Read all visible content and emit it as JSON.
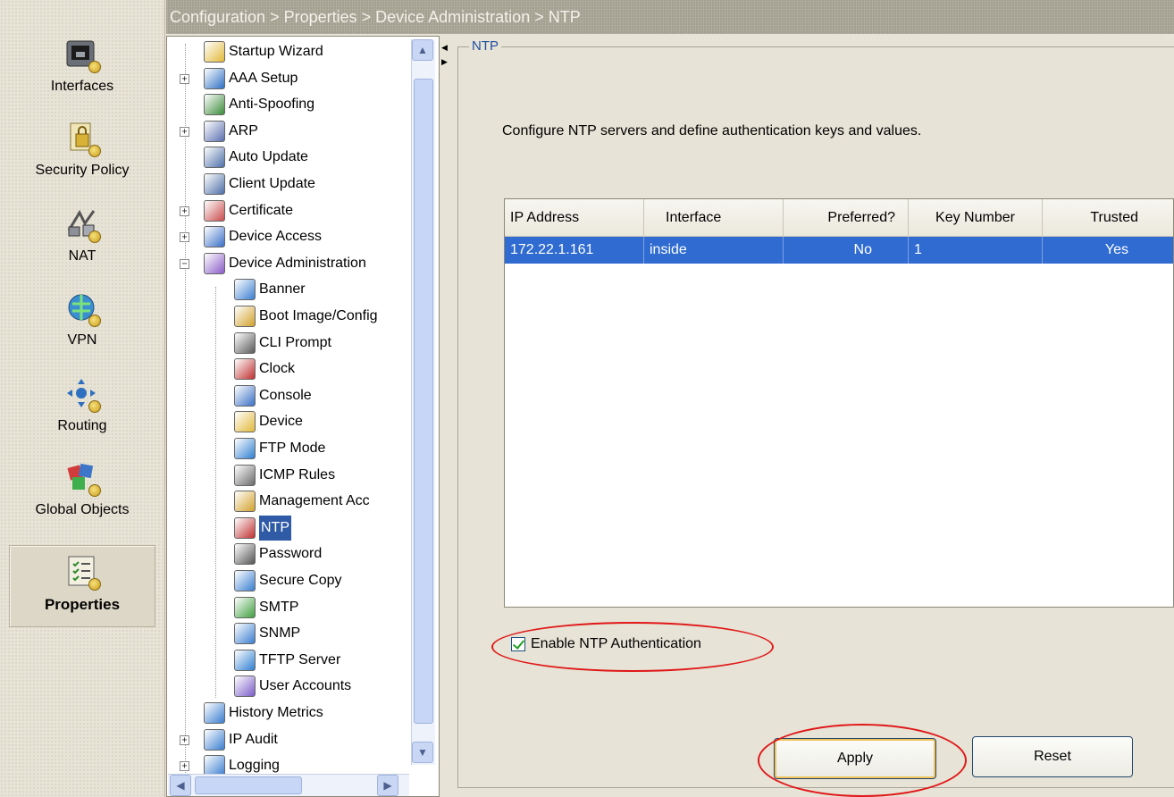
{
  "breadcrumb": "Configuration > Properties > Device Administration > NTP",
  "nav": {
    "items": [
      {
        "label": "Interfaces",
        "icon": "interfaces-icon"
      },
      {
        "label": "Security Policy",
        "icon": "security-policy-icon"
      },
      {
        "label": "NAT",
        "icon": "nat-icon"
      },
      {
        "label": "VPN",
        "icon": "vpn-icon"
      },
      {
        "label": "Routing",
        "icon": "routing-icon"
      },
      {
        "label": "Global Objects",
        "icon": "global-objects-icon"
      },
      {
        "label": "Properties",
        "icon": "properties-icon",
        "active": true
      }
    ]
  },
  "tree": {
    "items": [
      {
        "label": "Startup Wizard"
      },
      {
        "label": "AAA Setup",
        "expander": "+"
      },
      {
        "label": "Anti-Spoofing"
      },
      {
        "label": "ARP",
        "expander": "+"
      },
      {
        "label": "Auto Update"
      },
      {
        "label": "Client Update"
      },
      {
        "label": "Certificate",
        "expander": "+"
      },
      {
        "label": "Device Access",
        "expander": "+"
      },
      {
        "label": "Device Administration",
        "expander": "−"
      },
      {
        "label": "Banner"
      },
      {
        "label": "Boot Image/Config"
      },
      {
        "label": "CLI Prompt"
      },
      {
        "label": "Clock"
      },
      {
        "label": "Console"
      },
      {
        "label": "Device"
      },
      {
        "label": "FTP Mode"
      },
      {
        "label": "ICMP Rules"
      },
      {
        "label": "Management Acc"
      },
      {
        "label": "NTP",
        "selected": true
      },
      {
        "label": "Password"
      },
      {
        "label": "Secure Copy"
      },
      {
        "label": "SMTP"
      },
      {
        "label": "SNMP"
      },
      {
        "label": "TFTP Server"
      },
      {
        "label": "User Accounts"
      },
      {
        "label": "History Metrics"
      },
      {
        "label": "IP Audit",
        "expander": "+"
      },
      {
        "label": "Logging",
        "expander": "+"
      }
    ]
  },
  "panel": {
    "title": "NTP",
    "description": "Configure NTP servers and define authentication keys and values."
  },
  "table": {
    "columns": [
      "IP Address",
      "Interface",
      "Preferred?",
      "Key Number",
      "Trusted"
    ],
    "rows": [
      [
        "172.22.1.161",
        "inside",
        "No",
        "1",
        "Yes"
      ]
    ]
  },
  "auth_checkbox": {
    "label": "Enable NTP Authentication",
    "checked": true
  },
  "buttons": {
    "apply": "Apply",
    "reset": "Reset"
  },
  "colors": {
    "selection": "#2f6bd1",
    "highlight": "#e01818",
    "accent": "#1f4fa0"
  }
}
